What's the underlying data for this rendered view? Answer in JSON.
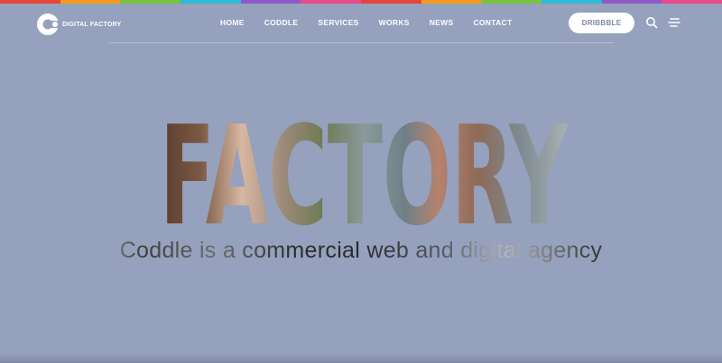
{
  "brand": {
    "name": "DIGITAL FACTORY"
  },
  "nav": {
    "items": [
      {
        "label": "HOME"
      },
      {
        "label": "CODDLE"
      },
      {
        "label": "SERVICES"
      },
      {
        "label": "WORKS"
      },
      {
        "label": "NEWS"
      },
      {
        "label": "CONTACT"
      }
    ],
    "cta_label": "DRIBBBLE",
    "icons": [
      "search-icon",
      "menu-icon"
    ]
  },
  "hero": {
    "headline": "FACTORY",
    "tagline": "Coddle is a commercial web and digital agency"
  },
  "colors": {
    "background": "#95a1bd",
    "accent_stripe": [
      "#e8443a",
      "#f29b1d",
      "#7cc242",
      "#2dbbd6",
      "#8e5ac8",
      "#e84a8a"
    ]
  }
}
